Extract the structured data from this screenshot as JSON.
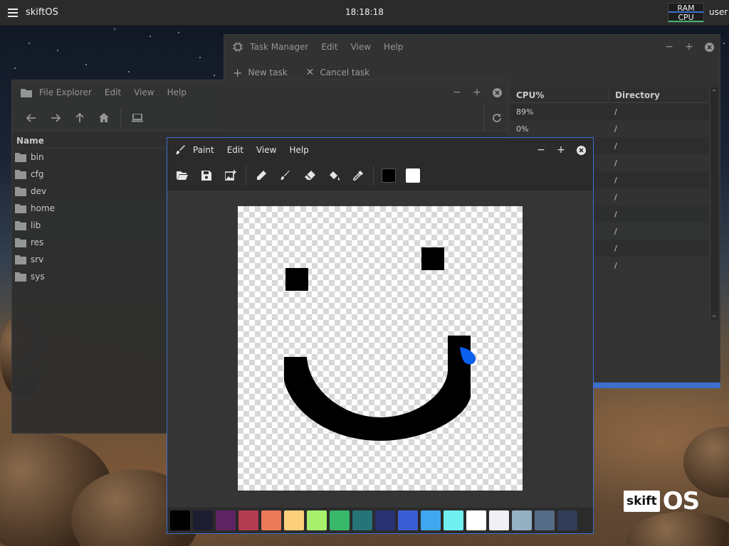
{
  "panel": {
    "app_name": "skiftOS",
    "clock": "18:18:18",
    "ram_label": "RAM",
    "cpu_label": "CPU",
    "user": "user",
    "ram_color": "#3b6fd0",
    "cpu_color": "#3cb371"
  },
  "watermark": {
    "brand_box": "skift",
    "brand_os": "OS"
  },
  "task_manager": {
    "title": "Task Manager",
    "menus": [
      "Edit",
      "View",
      "Help"
    ],
    "toolbar": {
      "new_task": "New task",
      "cancel_task": "Cancel task"
    },
    "columns": {
      "cpu": "CPU%",
      "directory": "Directory"
    },
    "rows": [
      {
        "cpu": "89%",
        "dir": "/"
      },
      {
        "cpu": "0%",
        "dir": "/"
      },
      {
        "cpu": "",
        "dir": "/"
      },
      {
        "cpu": "",
        "dir": "/"
      },
      {
        "cpu": "",
        "dir": "/"
      },
      {
        "cpu": "",
        "dir": "/"
      },
      {
        "cpu": "",
        "dir": "/"
      },
      {
        "cpu": "",
        "dir": "/"
      },
      {
        "cpu": "",
        "dir": "/"
      },
      {
        "cpu": "",
        "dir": "/"
      }
    ]
  },
  "file_explorer": {
    "title": "File Explorer",
    "menus": [
      "Edit",
      "View",
      "Help"
    ],
    "column_name": "Name",
    "entries": [
      "bin",
      "cfg",
      "dev",
      "home",
      "lib",
      "res",
      "srv",
      "sys"
    ]
  },
  "paint": {
    "title": "Paint",
    "menus": [
      "Edit",
      "View",
      "Help"
    ],
    "primary_color": "#000000",
    "secondary_color": "#ffffff",
    "drawing_color": "#000000",
    "drop_color": "#0a60f0",
    "palette": [
      "#000000",
      "#1e1e32",
      "#5e2462",
      "#b43c50",
      "#ea7a5a",
      "#fccf7a",
      "#a8f06c",
      "#38b868",
      "#267478",
      "#283270",
      "#3c5ed4",
      "#40a6f0",
      "#70f0f0",
      "#ffffff",
      "#f0f0f4",
      "#94b0c2",
      "#566c86",
      "#333c57"
    ]
  }
}
